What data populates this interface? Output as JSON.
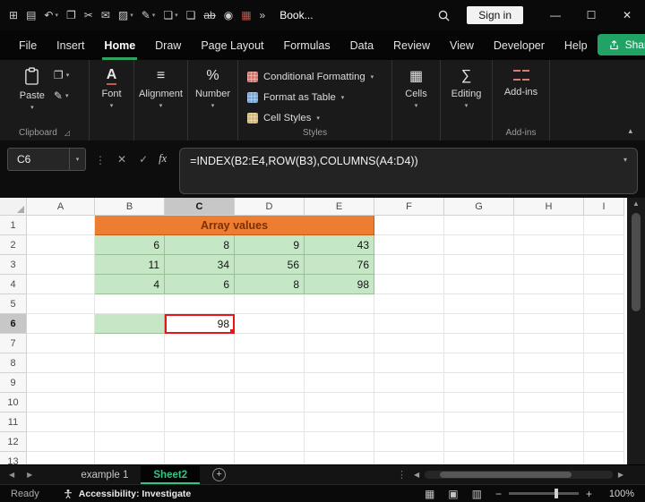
{
  "colors": {
    "accent_green": "#21a366",
    "sheet_tab_green": "#35c481",
    "header_orange": "#ED7D31",
    "orange_text": "#7b2f00",
    "cell_green": "#c6e7c6",
    "selection_red": "#e8131b"
  },
  "window": {
    "title": "Book...",
    "sign_in": "Sign in",
    "controls": {
      "minimize": "—",
      "maximize": "☐",
      "close": "✕"
    }
  },
  "qat": [
    {
      "name": "excel-icon",
      "glyph": "⊞",
      "dropdown": false
    },
    {
      "name": "save-icon",
      "glyph": "▤",
      "dropdown": false
    },
    {
      "name": "undo-icon",
      "glyph": "↶",
      "dropdown": true
    },
    {
      "name": "copy-icon",
      "glyph": "❐",
      "dropdown": false
    },
    {
      "name": "cut-icon",
      "glyph": "✂",
      "dropdown": false
    },
    {
      "name": "mail-icon",
      "glyph": "✉",
      "dropdown": false
    },
    {
      "name": "fill-color-icon",
      "glyph": "▨",
      "dropdown": true
    },
    {
      "name": "format-painter-icon",
      "glyph": "✎",
      "dropdown": true
    },
    {
      "name": "paste-icon",
      "glyph": "❏",
      "dropdown": true
    },
    {
      "name": "new-page-icon",
      "glyph": "❑",
      "dropdown": false
    },
    {
      "name": "strikethrough-icon",
      "glyph": "ab",
      "strike": true,
      "dropdown": false
    },
    {
      "name": "camera-icon",
      "glyph": "◉",
      "dropdown": false
    },
    {
      "name": "addin-grid-icon",
      "glyph": "▦",
      "color": "#c05a4e",
      "dropdown": false
    },
    {
      "name": "overflow-icon",
      "glyph": "»",
      "dropdown": false
    }
  ],
  "menubar": {
    "tabs": [
      "File",
      "Insert",
      "Home",
      "Draw",
      "Page Layout",
      "Formulas",
      "Data",
      "Review",
      "View",
      "Developer",
      "Help"
    ],
    "active_tab": "Home",
    "share": "Share"
  },
  "ribbon": {
    "paste": {
      "label": "Paste"
    },
    "clipboard_group": "Clipboard",
    "collapsed_groups": [
      {
        "name": "font",
        "label": "Font",
        "icon": "A"
      },
      {
        "name": "alignment",
        "label": "Alignment",
        "icon": "≡"
      },
      {
        "name": "number",
        "label": "Number",
        "icon": "%"
      }
    ],
    "styles": {
      "group_label": "Styles",
      "items": [
        {
          "name": "conditional-formatting",
          "label": "Conditional Formatting",
          "icon_color": "#e0736a"
        },
        {
          "name": "format-as-table",
          "label": "Format as Table",
          "icon_color": "#7aa7d9"
        },
        {
          "name": "cell-styles",
          "label": "Cell Styles",
          "icon_color": "#d9b96c"
        }
      ]
    },
    "right_groups": [
      {
        "name": "cells",
        "label": "Cells",
        "icon": "▦"
      },
      {
        "name": "editing",
        "label": "Editing",
        "icon": "∑"
      }
    ],
    "addins": {
      "label": "Add-ins",
      "group_label": "Add-ins"
    }
  },
  "formula_bar": {
    "name_box": "C6",
    "formula": "=INDEX(B2:E4,ROW(B3),COLUMNS(A4:D4))"
  },
  "grid": {
    "columns": [
      "A",
      "B",
      "C",
      "D",
      "E",
      "F",
      "G",
      "H",
      "I"
    ],
    "visible_rows": 13,
    "selected_column": "C",
    "selected_row": 6,
    "merged_title": {
      "ref": "B1:E1",
      "text": "Array values"
    },
    "array_block": {
      "ref": "B2:E4",
      "values": [
        [
          6,
          8,
          9,
          43
        ],
        [
          11,
          34,
          56,
          76
        ],
        [
          4,
          6,
          8,
          98
        ]
      ]
    },
    "green_cell": {
      "ref": "B6"
    },
    "active_cell": {
      "ref": "C6",
      "value": "98"
    }
  },
  "sheet_tabs": {
    "tabs": [
      "example 1",
      "Sheet2"
    ],
    "active": "Sheet2"
  },
  "status_bar": {
    "mode": "Ready",
    "accessibility": "Accessibility: Investigate",
    "zoom": "100%"
  }
}
